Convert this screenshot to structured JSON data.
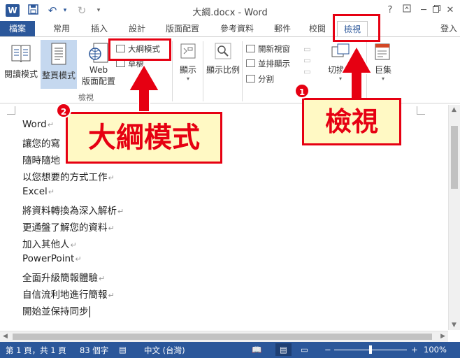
{
  "window": {
    "title": "大綱.docx - Word",
    "help": "?"
  },
  "tabs": {
    "file": "檔案",
    "items": [
      "常用",
      "插入",
      "設計",
      "版面配置",
      "參考資料",
      "郵件",
      "校閱",
      "檢視"
    ],
    "active": "檢視",
    "signin": "登入"
  },
  "ribbon": {
    "views": {
      "read_mode": "閱讀模式",
      "print_layout": "整頁模式",
      "web_layout_1": "Web",
      "web_layout_2": "版面配置",
      "outline": "大綱模式",
      "draft": "草稿",
      "group_label": "檢視"
    },
    "show": "顯示",
    "zoom": "顯示比例",
    "window": {
      "new_window": "開新視窗",
      "arrange_all": "並排顯示",
      "split": "分割",
      "switch": "切換視"
    },
    "macros": "巨集"
  },
  "document": {
    "lines": [
      "Word",
      "讓您的寫",
      "隨時隨地",
      "以您想要的方式工作",
      "Excel",
      "將資料轉換為深入解析",
      "更通盤了解您的資料",
      "加入其他人",
      "PowerPoint",
      "全面升級簡報體驗",
      "自信流利地進行簡報",
      "開始並保持同步"
    ]
  },
  "status": {
    "page": "第 1 頁，共 1 頁",
    "words": "83 個字",
    "language": "中文 (台灣)",
    "zoom": "100%"
  },
  "annotations": {
    "callout1_number": "1",
    "callout1_text": "檢視",
    "callout2_number": "2",
    "callout2_text": "大綱模式",
    "color": "#e60012"
  }
}
